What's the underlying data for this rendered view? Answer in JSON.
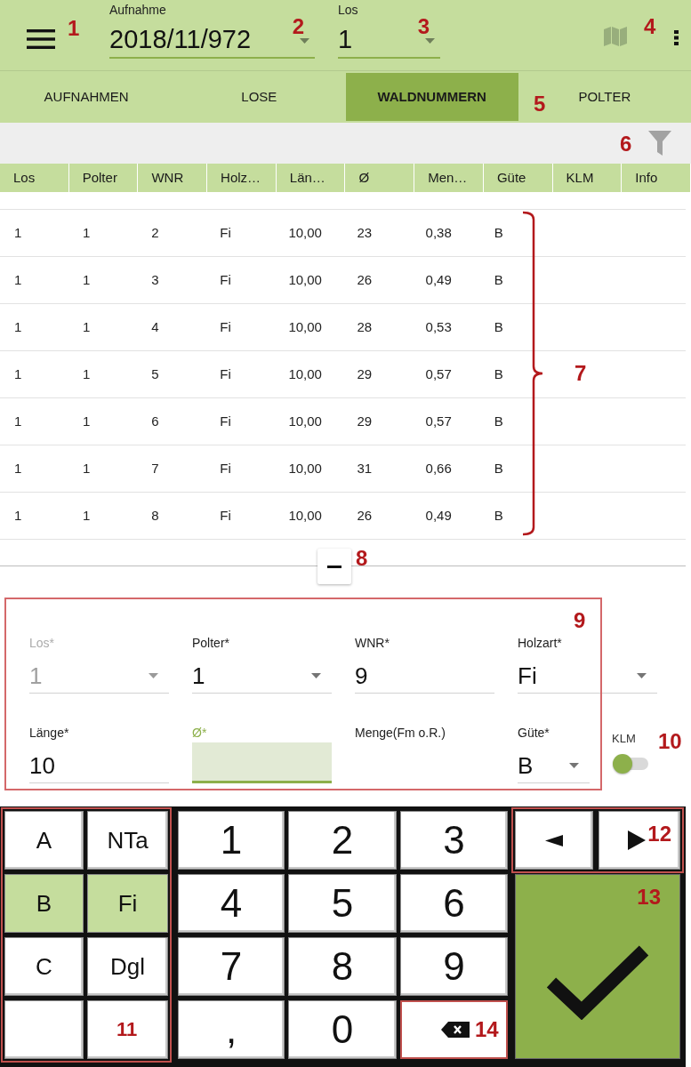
{
  "top_bar": {
    "menu_callout": "1",
    "fields": [
      {
        "label": "Aufnahme",
        "value": "2018/11/972",
        "callout": "2"
      },
      {
        "label": "Los",
        "value": "1",
        "callout": "3"
      }
    ],
    "actions_callout": "4"
  },
  "tabs": {
    "items": [
      {
        "label": "AUFNAHMEN",
        "selected": false
      },
      {
        "label": "LOSE",
        "selected": false
      },
      {
        "label": "WALDNUMMERN",
        "selected": true
      },
      {
        "label": "POLTER",
        "selected": false
      }
    ],
    "callout": "5"
  },
  "filter_bar": {
    "callout": "6"
  },
  "table": {
    "columns": [
      "Los",
      "Polter",
      "WNR",
      "Holz…",
      "Län…",
      "Ø",
      "Men…",
      "Güte",
      "KLM",
      "Info"
    ],
    "rows": [
      [
        "1",
        "1",
        "2",
        "Fi",
        "10,00",
        "23",
        "0,38",
        "B"
      ],
      [
        "1",
        "1",
        "3",
        "Fi",
        "10,00",
        "26",
        "0,49",
        "B"
      ],
      [
        "1",
        "1",
        "4",
        "Fi",
        "10,00",
        "28",
        "0,53",
        "B"
      ],
      [
        "1",
        "1",
        "5",
        "Fi",
        "10,00",
        "29",
        "0,57",
        "B"
      ],
      [
        "1",
        "1",
        "6",
        "Fi",
        "10,00",
        "29",
        "0,57",
        "B"
      ],
      [
        "1",
        "1",
        "7",
        "Fi",
        "10,00",
        "31",
        "0,66",
        "B"
      ],
      [
        "1",
        "1",
        "8",
        "Fi",
        "10,00",
        "26",
        "0,49",
        "B"
      ]
    ],
    "callout": "7"
  },
  "collapse_button": {
    "callout": "8"
  },
  "form": {
    "outlined": true,
    "callout": "9",
    "fields": [
      {
        "kind": "select",
        "label": "Los*",
        "value": "1",
        "disabled": true,
        "focused": false
      },
      {
        "kind": "select",
        "label": "Polter*",
        "value": "1",
        "disabled": false,
        "focused": false
      },
      {
        "kind": "text",
        "label": "WNR*",
        "value": "9",
        "disabled": false,
        "focused": false
      },
      {
        "kind": "select",
        "label": "Holzart*",
        "value": "Fi",
        "disabled": false,
        "focused": false
      },
      {
        "kind": "text",
        "label": "Länge*",
        "value": "10",
        "disabled": false,
        "focused": false
      },
      {
        "kind": "text",
        "label": "Ø*",
        "disabled": false,
        "focused": true
      },
      {
        "kind": "readout",
        "label": "Menge(Fm o.R.)",
        "disabled": false,
        "focused": false
      },
      {
        "kind": "select",
        "label": "Güte*",
        "value": "B",
        "disabled": false,
        "focused": false
      }
    ],
    "klm": {
      "label": "KLM",
      "on": false,
      "callout": "10"
    }
  },
  "keypad": {
    "letters": {
      "outlined": true,
      "keys": [
        {
          "label": "A",
          "selected": false
        },
        {
          "label": "NTa",
          "selected": false
        },
        {
          "label": "B",
          "selected": true
        },
        {
          "label": "Fi",
          "selected": true
        },
        {
          "label": "C",
          "selected": false
        },
        {
          "label": "Dgl",
          "selected": false
        },
        {
          "selected": false
        },
        {
          "selected": false,
          "callout": "11"
        }
      ]
    },
    "digits": {
      "keys": [
        {
          "kind": "digit",
          "label": "1"
        },
        {
          "kind": "digit",
          "label": "2"
        },
        {
          "kind": "digit",
          "label": "3"
        },
        {
          "kind": "digit",
          "label": "4"
        },
        {
          "kind": "digit",
          "label": "5"
        },
        {
          "kind": "digit",
          "label": "6"
        },
        {
          "kind": "digit",
          "label": "7"
        },
        {
          "kind": "digit",
          "label": "8"
        },
        {
          "kind": "digit",
          "label": "9"
        },
        {
          "kind": "digit",
          "label": ","
        },
        {
          "kind": "digit",
          "label": "0"
        },
        {
          "kind": "backspace",
          "outlined": true,
          "callout": "14"
        }
      ]
    },
    "nav": {
      "outlined": true,
      "callout": "12",
      "keys": [
        {
          "kind": "left"
        },
        {
          "kind": "right"
        }
      ]
    },
    "confirm": {
      "callout": "13"
    }
  }
}
